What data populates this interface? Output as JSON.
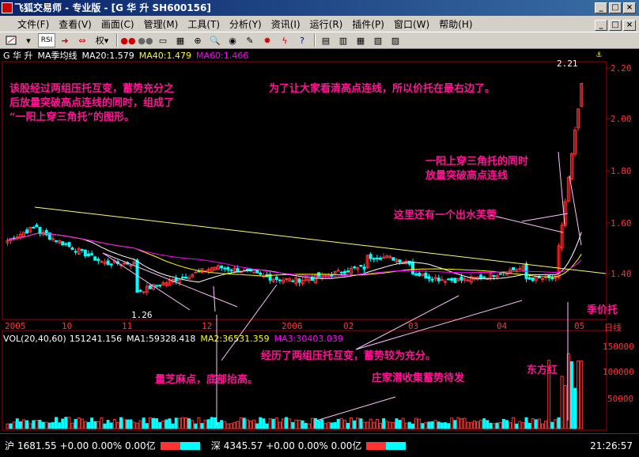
{
  "window": {
    "title": "飞狐交易师 - 专业版 - [G 华 升 SH600156]",
    "min": "_",
    "max": "□",
    "close": "×"
  },
  "menu": [
    "文件(F)",
    "查看(V)",
    "画面(C)",
    "管理(M)",
    "工具(T)",
    "分析(Y)",
    "资讯(I)",
    "运行(R)",
    "插件(P)",
    "窗口(W)",
    "帮助(H)"
  ],
  "toolbar": {
    "dropdown_label": "权",
    "rsi_label": "RSI"
  },
  "infobar": {
    "stock": "G 华  升",
    "indicator": "MA季均线",
    "ma20": "MA20:1.579",
    "ma40": "MA40:1.479",
    "ma60": "MA60:1.466"
  },
  "price_axis": [
    "2.20",
    "2.00",
    "1.80",
    "1.60",
    "1.40"
  ],
  "price_high_label": "2.21",
  "price_low_label": "1.26",
  "x_labels": [
    "2005",
    "10",
    "11",
    "12",
    "2006",
    "02",
    "03",
    "04",
    "05",
    "日线"
  ],
  "vol_info": {
    "label": "VOL(20,40,60)",
    "vol": "151241.156",
    "ma1": "MA1:59328.418",
    "ma2": "MA2:36531.359",
    "ma3": "MA3:30403.039"
  },
  "vol_axis": [
    "150000",
    "100000",
    "50000"
  ],
  "annotations": {
    "a1_l1": "该股经过两组压托互变，蓄势充分之",
    "a1_l2": "后放量突破高点连线的同时，组成了",
    "a1_l3": "“一阳上穿三角托”的图形。",
    "a2": "为了让大家看清高点连线，所以价托在最右边了。",
    "a3_l1": "一阳上穿三角托的同时",
    "a3_l2": "放量突破高点连线",
    "a4": "这里还有一个出水芙蓉",
    "a5": "季价托",
    "a6": "经历了两组压托互变，蓄势较为充分。",
    "a7": "量芝麻点，底部抬高。",
    "a8": "庄家潜收集蓄势待发",
    "a9": "东方红"
  },
  "status": {
    "sh_label": "沪",
    "sh_value": "1681.55 +0.00 0.00% 0.00亿",
    "sz_label": "深",
    "sz_value": "4345.57 +0.00 0.00% 0.00亿",
    "time": "21:26:57"
  },
  "colors": {
    "up": "#ff3333",
    "down": "#00ffff",
    "ma20": "#ffffff",
    "ma40": "#ffff00",
    "ma60": "#ff00ff",
    "annotation": "#ff1493"
  }
}
